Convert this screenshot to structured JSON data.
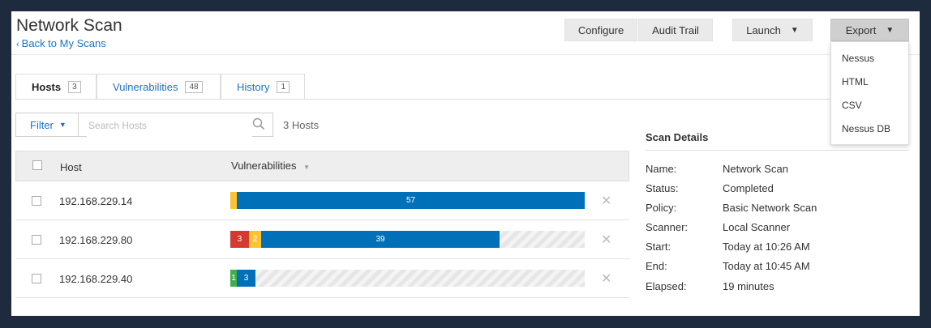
{
  "header": {
    "title": "Network Scan",
    "back_link": "Back to My Scans"
  },
  "toolbar": {
    "configure": "Configure",
    "audit_trail": "Audit Trail",
    "launch": "Launch",
    "export": "Export"
  },
  "export_menu": [
    "Nessus",
    "HTML",
    "CSV",
    "Nessus DB"
  ],
  "tabs": [
    {
      "label": "Hosts",
      "count": "3"
    },
    {
      "label": "Vulnerabilities",
      "count": "48"
    },
    {
      "label": "History",
      "count": "1"
    }
  ],
  "filter": {
    "label": "Filter",
    "search_placeholder": "Search Hosts",
    "host_count": "3 Hosts"
  },
  "table": {
    "headers": {
      "host": "Host",
      "vulnerabilities": "Vulnerabilities"
    },
    "rows": [
      {
        "host": "192.168.229.14",
        "segments": [
          {
            "severity": "medium",
            "count": 1,
            "label": ""
          },
          {
            "severity": "info",
            "count": 57,
            "label": "57"
          }
        ]
      },
      {
        "host": "192.168.229.80",
        "segments": [
          {
            "severity": "high",
            "count": 3,
            "label": "3"
          },
          {
            "severity": "medium",
            "count": 2,
            "label": "2"
          },
          {
            "severity": "info",
            "count": 39,
            "label": "39"
          }
        ]
      },
      {
        "host": "192.168.229.40",
        "segments": [
          {
            "severity": "low",
            "count": 1,
            "label": "1"
          },
          {
            "severity": "info",
            "count": 3,
            "label": "3"
          }
        ]
      }
    ]
  },
  "severity_colors": {
    "high": "#d43a2f",
    "medium": "#fdc431",
    "low": "#3fae49",
    "info": "#0071b9"
  },
  "scan_details": {
    "title": "Scan Details",
    "fields": [
      {
        "key": "Name:",
        "value": "Network Scan"
      },
      {
        "key": "Status:",
        "value": "Completed"
      },
      {
        "key": "Policy:",
        "value": "Basic Network Scan"
      },
      {
        "key": "Scanner:",
        "value": "Local Scanner"
      },
      {
        "key": "Start:",
        "value": "Today at 10:26 AM"
      },
      {
        "key": "End:",
        "value": "Today at 10:45 AM"
      },
      {
        "key": "Elapsed:",
        "value": "19 minutes"
      }
    ]
  }
}
